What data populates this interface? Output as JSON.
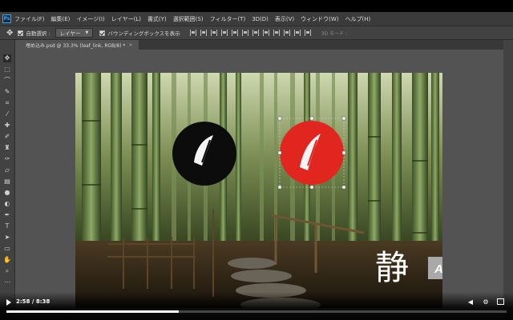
{
  "app": {
    "logo_text": "Ps",
    "menus": [
      "ファイル(F)",
      "編集(E)",
      "イメージ(I)",
      "レイヤー(L)",
      "書式(Y)",
      "選択範囲(S)",
      "フィルター(T)",
      "3D(D)",
      "表示(V)",
      "ウィンドウ(W)",
      "ヘルプ(H)"
    ]
  },
  "options": {
    "auto_select_label": "自動選択 :",
    "auto_select_value": "レイヤー",
    "bounding_box_label": "バウンディングボックスを表示",
    "mode_3d_label": "3D モード :"
  },
  "document": {
    "tab_title": "埋め込み.psd @ 33.3% (leaf_link, RGB/8) *",
    "close_glyph": "×"
  },
  "canvas": {
    "kanji": "静",
    "logo_text": "Attain",
    "colors": {
      "black_circle": "#0c0c0c",
      "red_circle": "#e0261e",
      "logo_bg": "#a9a9a9"
    }
  },
  "video": {
    "time_display": "2:58 / 8:38",
    "progress": 0.344
  },
  "colors": {
    "menubar": "#3b3b3b",
    "optionsbar": "#424242",
    "workspace": "#535353",
    "toolbar": "#424242"
  }
}
